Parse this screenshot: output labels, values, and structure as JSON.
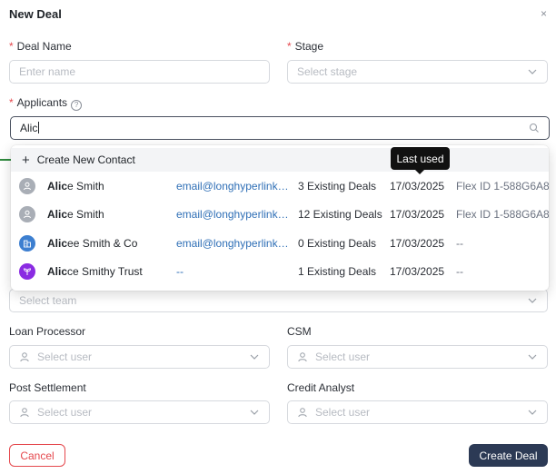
{
  "dialog": {
    "title": "New Deal",
    "close": "×"
  },
  "deal_name": {
    "label": "Deal Name",
    "required": "*",
    "placeholder": "Enter name"
  },
  "stage": {
    "label": "Stage",
    "required": "*",
    "placeholder": "Select stage"
  },
  "applicants": {
    "label": "Applicants",
    "required": "*",
    "help": "?",
    "value": "Alic"
  },
  "dropdown": {
    "create_label": "Create New Contact",
    "tooltip": "Last used",
    "rows": [
      {
        "name_bold": "Alic",
        "name_rest": "e Smith",
        "email": "email@longhyperlinkingaddress.com",
        "deals": "3 Existing Deals",
        "date": "17/03/2025",
        "flex": "Flex ID 1-588G6A8",
        "avatar": "person-icon"
      },
      {
        "name_bold": "Alic",
        "name_rest": "e Smith",
        "email": "email@longhyperlinkingaddress.com",
        "deals": "12 Existing Deals",
        "date": "17/03/2025",
        "flex": "Flex ID 1-588G6A8",
        "avatar": "person-icon"
      },
      {
        "name_bold": "Alic",
        "name_rest": "ee Smith & Co",
        "email": "email@longhyperlinkingaddress.com",
        "deals": "0 Existing Deals",
        "date": "17/03/2025",
        "flex": "--",
        "avatar": "building-icon"
      },
      {
        "name_bold": "Alic",
        "name_rest": "ce Smithy Trust",
        "email": "--",
        "deals": "1 Existing Deals",
        "date": "17/03/2025",
        "flex": "--",
        "avatar": "sprout-icon"
      }
    ]
  },
  "team": {
    "placeholder": "Select team"
  },
  "loan_processor": {
    "label": "Loan Processor",
    "placeholder": "Select user"
  },
  "csm": {
    "label": "CSM",
    "placeholder": "Select user"
  },
  "post_settlement": {
    "label": "Post Settlement",
    "placeholder": "Select user"
  },
  "credit_analyst": {
    "label": "Credit Analyst",
    "placeholder": "Select user"
  },
  "actions": {
    "cancel": "Cancel",
    "create": "Create Deal"
  },
  "colors": {
    "required": "#e5484d",
    "link": "#2f6fb6",
    "primary": "#2c3a55",
    "company_avatar": "#3d7fd0",
    "trust_avatar": "#8a2be2"
  }
}
